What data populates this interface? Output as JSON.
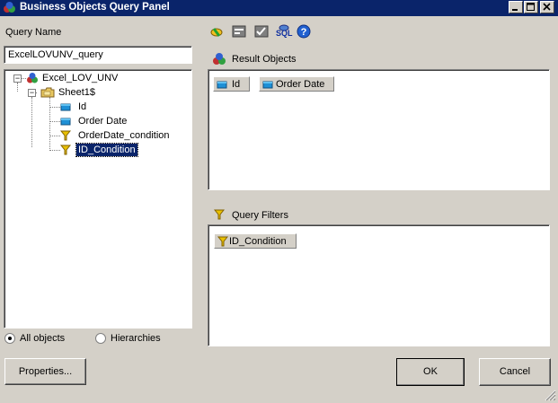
{
  "window": {
    "title": "Business Objects Query Panel"
  },
  "query_name": {
    "label": "Query Name",
    "value": "ExcelLOVUNV_query"
  },
  "tree": {
    "root": "Excel_LOV_UNV",
    "folder": "Sheet1$",
    "items": [
      {
        "label": "Id",
        "type": "dimension"
      },
      {
        "label": "Order Date",
        "type": "dimension"
      },
      {
        "label": "OrderDate_condition",
        "type": "filter"
      },
      {
        "label": "ID_Condition",
        "type": "filter",
        "selected": true
      }
    ]
  },
  "view_options": {
    "all_objects": "All objects",
    "hierarchies": "Hierarchies",
    "selected": "all_objects"
  },
  "result_objects": {
    "label": "Result Objects",
    "items": [
      "Id",
      "Order Date"
    ]
  },
  "query_filters": {
    "label": "Query Filters",
    "items": [
      "ID_Condition"
    ]
  },
  "toolbar": {
    "sql_label": "SQL"
  },
  "buttons": {
    "properties": "Properties...",
    "ok": "OK",
    "cancel": "Cancel"
  },
  "colors": {
    "titlebar": "#0a246a",
    "face": "#d4d0c8",
    "selection": "#0a246a",
    "dimension_icon": "#1e90d6",
    "filter_icon": "#e8c000"
  }
}
